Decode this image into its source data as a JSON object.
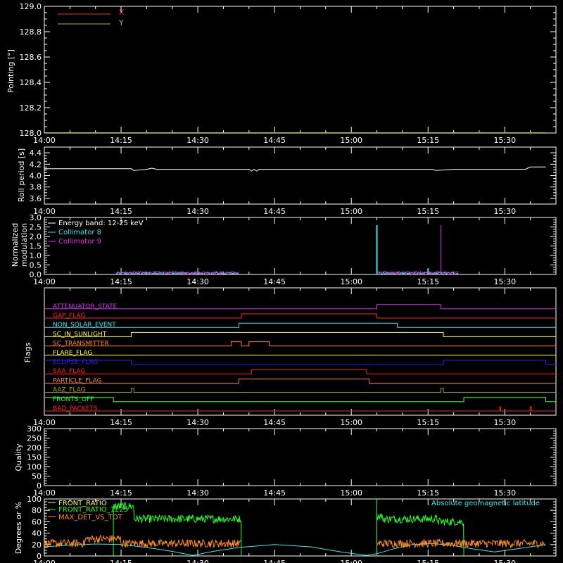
{
  "colors": {
    "background": "#000000",
    "foreground": "#ffffff",
    "red": "#ff2020",
    "olive": "#b8b030",
    "cyan": "#30e8e8",
    "magenta": "#e030e0",
    "green": "#20ff20",
    "orange": "#ff8c20",
    "yellow": "#ffff30",
    "blue": "#2020ff",
    "lime_flag": "#30ff30",
    "attenuator": "#d030e8",
    "transmitter": "#ff8020",
    "particle": "#ff8040",
    "aaz": "#a0a030"
  },
  "time_axis": {
    "start_minutes": 840,
    "end_minutes": 940,
    "tick_labels": [
      "14:00",
      "14:15",
      "14:30",
      "14:45",
      "15:00",
      "15:15",
      "15:30"
    ]
  },
  "chart_data": [
    {
      "id": "pointing",
      "type": "line",
      "ylabel": "Pointing [°]",
      "ylim": [
        128.0,
        129.0
      ],
      "yticks": [
        "128.0",
        "128.2",
        "128.4",
        "128.6",
        "128.8",
        "129.0"
      ],
      "legend_placement": "top-left",
      "series": [
        {
          "name": "X",
          "color": "#ff2020",
          "x": [
            "14:00",
            "15:38"
          ],
          "y": [
            128.0,
            128.0
          ]
        },
        {
          "name": "Y",
          "color": "#b8b030",
          "x": [
            "14:00",
            "15:38"
          ],
          "y": [
            128.0,
            128.0
          ]
        }
      ]
    },
    {
      "id": "roll",
      "type": "line",
      "ylabel": "Roll period [s]",
      "ylim": [
        3.5,
        4.5
      ],
      "yticks": [
        "3.6",
        "3.8",
        "4.0",
        "4.2",
        "4.4"
      ],
      "series": [
        {
          "color": "#ffffff",
          "x": [
            "14:00",
            "14:17",
            "14:17.5",
            "14:20",
            "14:21",
            "14:22",
            "14:40",
            "14:40.5",
            "14:41",
            "14:41.5",
            "14:42",
            "15:10",
            "15:16",
            "15:16.5",
            "15:20",
            "15:25",
            "15:34",
            "15:35",
            "15:38"
          ],
          "y": [
            4.12,
            4.12,
            4.09,
            4.11,
            4.13,
            4.11,
            4.11,
            4.08,
            4.11,
            4.08,
            4.11,
            4.11,
            4.11,
            4.09,
            4.11,
            4.11,
            4.11,
            4.15,
            4.15
          ]
        }
      ]
    },
    {
      "id": "modulation",
      "type": "line",
      "ylabel": "Normalized modulation",
      "ylim": [
        0.0,
        3.0
      ],
      "yticks": [
        "0.0",
        "0.5",
        "1.0",
        "1.5",
        "2.0",
        "2.5",
        "3.0"
      ],
      "legend_placement": "top-left",
      "annotation": "Energy band: 12-25 keV",
      "segments": [
        [
          "14:14",
          "14:38"
        ],
        [
          "15:05",
          "15:21"
        ]
      ],
      "series": [
        {
          "name": "Collimator 8",
          "color": "#30e8e8",
          "baseline": 0.06,
          "spikes": [
            [
              "15:05",
              2.6
            ],
            [
              "15:15",
              0.3
            ]
          ]
        },
        {
          "name": "Collimator 9",
          "color": "#e030e0",
          "baseline": 0.1,
          "spikes": [
            [
              "15:17.5",
              2.6
            ]
          ]
        }
      ]
    },
    {
      "id": "flags",
      "type": "step",
      "ylabel": "Flags",
      "flags": [
        {
          "name": "ATTENUATOR_STATE",
          "color": "#d030e8",
          "intervals": [
            [
              "15:05",
              "15:17.5"
            ]
          ]
        },
        {
          "name": "GAP_FLAG",
          "color": "#ff2020",
          "intervals": [
            [
              "14:38.5",
              "15:05"
            ]
          ]
        },
        {
          "name": "NON_SOLAR_EVENT",
          "color": "#30e8e8",
          "intervals": [
            [
              "14:38",
              "15:09"
            ]
          ]
        },
        {
          "name": "SC_IN_SUNLIGHT",
          "color": "#ffff30",
          "intervals": [
            [
              "14:17",
              "15:18"
            ]
          ]
        },
        {
          "name": "SC_TRANSMITTER",
          "color": "#ff8020",
          "intervals": [
            [
              "14:36.5",
              "14:38.5"
            ],
            [
              "14:40",
              "14:44"
            ]
          ]
        },
        {
          "name": "FLARE_FLAG",
          "color": "#ffff30",
          "intervals": []
        },
        {
          "name": "ECLIPSE_FLAG",
          "color": "#2020ff",
          "intervals": [
            [
              "14:00",
              "14:17"
            ],
            [
              "15:18",
              "15:38"
            ]
          ]
        },
        {
          "name": "SAA_FLAG",
          "color": "#ff2020",
          "intervals": [
            [
              "14:40.5",
              "15:03"
            ]
          ]
        },
        {
          "name": "PARTICLE_FLAG",
          "color": "#ff8040",
          "intervals": [
            [
              "14:38",
              "15:03.5"
            ]
          ]
        },
        {
          "name": "AAZ_FLAG",
          "color": "#a0a030",
          "intervals": [
            [
              "14:17",
              "14:17.5"
            ],
            [
              "15:17.5",
              "15:18"
            ]
          ]
        },
        {
          "name": "FRONTS_OFF",
          "color": "#30ff30",
          "intervals": [
            [
              "14:00",
              "14:13.5"
            ],
            [
              "15:22",
              "15:38"
            ]
          ]
        },
        {
          "name": "BAD_PACKETS",
          "color": "#ff2020",
          "intervals": [
            [
              "15:29",
              "15:29.2"
            ],
            [
              "15:35",
              "15:35.2"
            ]
          ]
        }
      ]
    },
    {
      "id": "quality",
      "type": "line",
      "ylabel": "Quality",
      "ylim": [
        0,
        300
      ],
      "yticks": [
        "0",
        "50",
        "100",
        "150",
        "200",
        "250",
        "300"
      ],
      "series": []
    },
    {
      "id": "front_ratio",
      "type": "line",
      "ylabel": "Degrees or %",
      "ylim": [
        0,
        100
      ],
      "yticks": [
        "0",
        "20",
        "40",
        "60",
        "80",
        "100"
      ],
      "legend_placement": "top-left",
      "series": [
        {
          "name": "FRONT_RATIO",
          "color": "#ffff30",
          "segments": [
            [
              "14:13.5",
              "14:38.5"
            ],
            [
              "15:05",
              "15:22"
            ]
          ]
        },
        {
          "name": "FRONT_RATIO_1225",
          "color": "#20ff20",
          "segments": [
            [
              "14:13.5",
              "14:38.5"
            ],
            [
              "15:05",
              "15:22"
            ]
          ],
          "level": 65,
          "peak": 95
        },
        {
          "name": "MAX_DET_VS_TOT",
          "color": "#ff8c20",
          "segments": [
            [
              "14:00",
              "14:38.5"
            ],
            [
              "15:05",
              "15:38"
            ]
          ],
          "level": 22
        }
      ],
      "secondary_series": {
        "name": "Absolute geomagnetic latitude",
        "color": "#30e8e8",
        "placement": "top-right",
        "x": [
          "14:00",
          "14:05",
          "14:10",
          "14:15",
          "14:20",
          "14:25",
          "14:29",
          "14:33",
          "14:38",
          "14:45",
          "14:52",
          "14:58",
          "15:03",
          "15:05",
          "15:08",
          "15:12",
          "15:16",
          "15:20",
          "15:24",
          "15:28",
          "15:32",
          "15:38"
        ],
        "y": [
          16,
          19,
          21,
          20,
          15,
          8,
          1,
          8,
          15,
          20,
          16,
          7,
          1,
          4,
          12,
          20,
          22,
          18,
          12,
          7,
          12,
          20
        ]
      }
    }
  ]
}
